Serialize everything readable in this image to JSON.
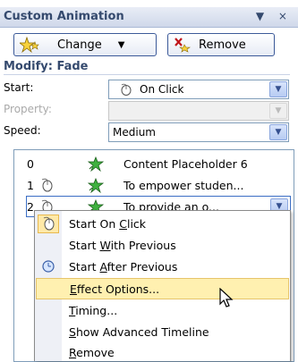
{
  "pane": {
    "title": "Custom Animation",
    "title_controls": "▼ ×"
  },
  "toolbar": {
    "change_label": "Change",
    "remove_label": "Remove"
  },
  "modify": {
    "heading": "Modify: Fade",
    "start_label": "Start:",
    "start_value": "On Click",
    "property_label": "Property:",
    "property_value": "",
    "speed_label": "Speed:",
    "speed_value": "Medium"
  },
  "list": {
    "items": [
      {
        "num": "0",
        "name": "Content Placeholder 6"
      },
      {
        "num": "1",
        "name": "To empower studen..."
      },
      {
        "num": "2",
        "name": "To provide an o..."
      }
    ]
  },
  "menu": {
    "items": [
      {
        "pre": "Start On ",
        "u": "C",
        "post": "lick"
      },
      {
        "pre": "Start ",
        "u": "W",
        "post": "ith Previous"
      },
      {
        "pre": "Start ",
        "u": "A",
        "post": "fter Previous"
      },
      {
        "pre": "",
        "u": "E",
        "post": "ffect Options..."
      },
      {
        "pre": "",
        "u": "T",
        "post": "iming..."
      },
      {
        "pre": "",
        "u": "S",
        "post": "how Advanced Timeline"
      },
      {
        "pre": "",
        "u": "R",
        "post": "emove"
      }
    ]
  },
  "icons": {
    "change": "star-effect-icon",
    "remove": "remove-effect-icon",
    "on_click": "mouse-icon",
    "effect_star": "green-star-icon",
    "after_previous": "clock-icon"
  },
  "colors": {
    "title_text": "#354a6e",
    "highlight": "#fff0b0",
    "border_blue": "#3b6ec4"
  }
}
